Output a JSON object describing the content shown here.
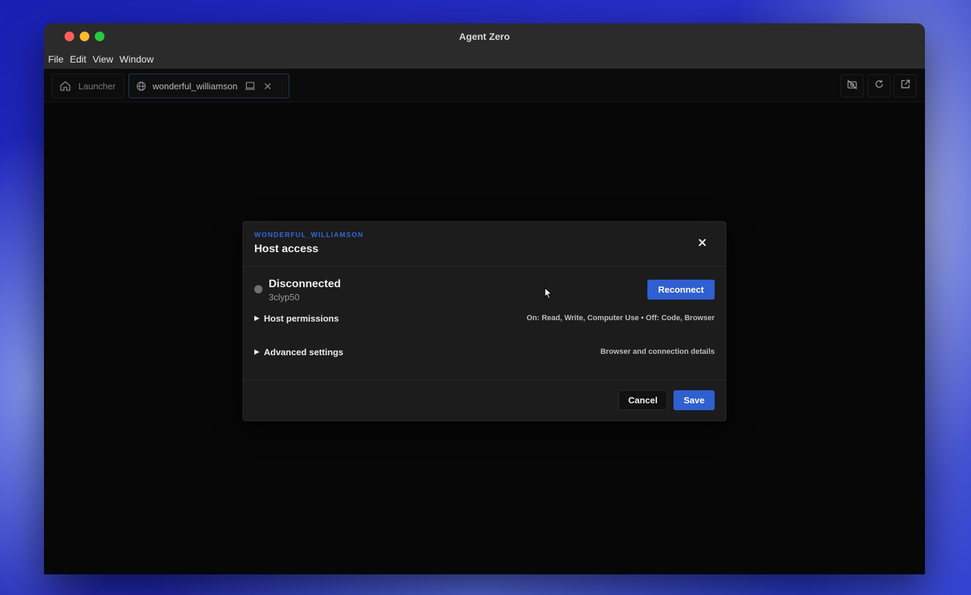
{
  "window": {
    "title": "Agent Zero",
    "menu": [
      "File",
      "Edit",
      "View",
      "Window"
    ]
  },
  "tabs": {
    "launcher": {
      "label": "Launcher",
      "icon": "home-icon"
    },
    "active": {
      "label": "wonderful_williamson",
      "icon": "globe-icon",
      "secondary_icon": "laptop-icon",
      "close_icon": "close-icon"
    }
  },
  "toolbar": {
    "icons": [
      "no-camera-icon",
      "refresh-icon",
      "open-external-icon"
    ]
  },
  "dialog": {
    "eyebrow": "WONDERFUL_WILLIAMSON",
    "title": "Host access",
    "status": {
      "label": "Disconnected",
      "id": "3clyp50",
      "color": "#6e6e6e"
    },
    "reconnect_label": "Reconnect",
    "sections": [
      {
        "label": "Host permissions",
        "detail": "On: Read, Write, Computer Use • Off: Code, Browser"
      },
      {
        "label": "Advanced settings",
        "detail": "Browser and connection details"
      }
    ],
    "cancel_label": "Cancel",
    "save_label": "Save"
  },
  "colors": {
    "accent": "#2f5fd0",
    "eyebrow": "#3566d6",
    "window_bg": "#070707",
    "dialog_bg": "#1c1c1d"
  }
}
